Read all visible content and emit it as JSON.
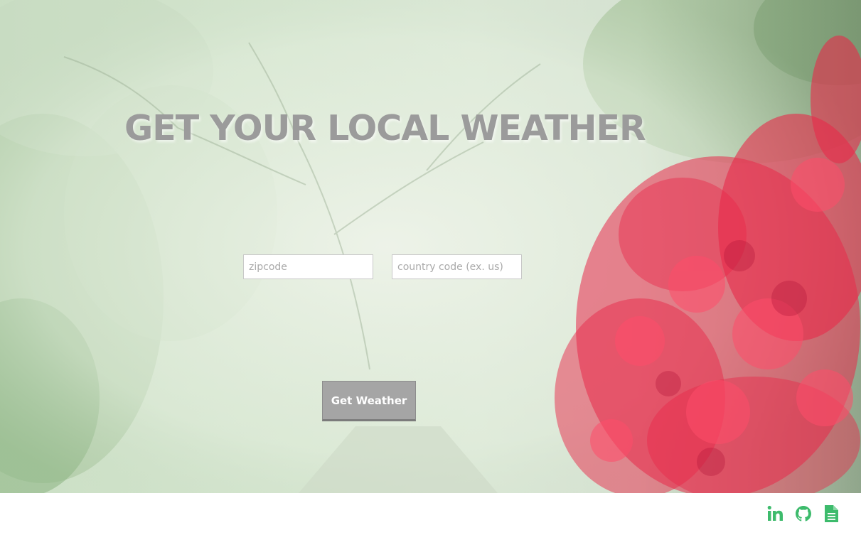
{
  "hero": {
    "title": "GET YOUR LOCAL WEATHER"
  },
  "form": {
    "zipcode_placeholder": "zipcode",
    "zipcode_value": "",
    "country_placeholder": "country code (ex. us)",
    "country_value": "",
    "submit_label": "Get Weather"
  },
  "footer": {
    "links": [
      {
        "icon": "linkedin-icon"
      },
      {
        "icon": "github-icon"
      },
      {
        "icon": "document-icon"
      }
    ],
    "icon_color": "#3dbb6c"
  },
  "colors": {
    "title": "#9b9b9b",
    "button": "#a5a5a5",
    "flowers": "#e8294a"
  }
}
